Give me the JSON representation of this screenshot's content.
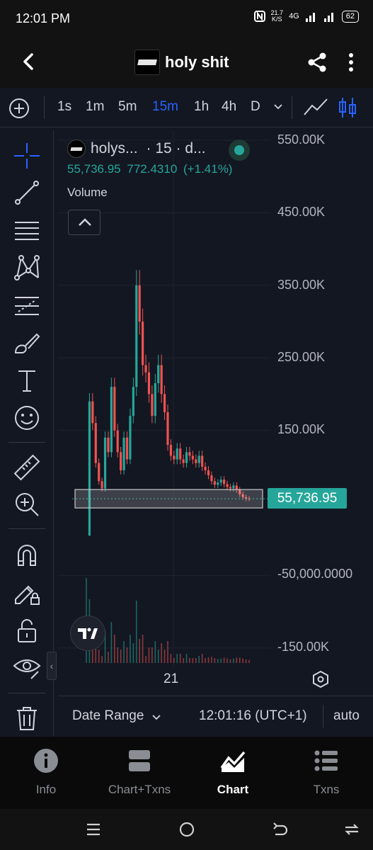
{
  "status_bar": {
    "time": "12:01 PM",
    "net_speed_value": "21.7",
    "net_speed_unit": "K/S",
    "network": "4G",
    "battery": "62"
  },
  "header": {
    "title": "holy shit",
    "back_icon": "chevron-left-icon",
    "share_icon": "share-icon",
    "more_icon": "more-vertical-icon"
  },
  "toolbar": {
    "timeframes": [
      "1s",
      "1m",
      "5m",
      "15m",
      "1h",
      "4h",
      "D"
    ],
    "active_timeframe": "15m"
  },
  "legend": {
    "symbol": "holys...",
    "meta": "· 15 · d...",
    "last": "55,736.95",
    "change": "772.4310",
    "change_pct": "(+1.41%)",
    "volume_label": "Volume"
  },
  "price_axis": {
    "labels": [
      "550.00K",
      "450.00K",
      "350.00K",
      "250.00K",
      "150.00K",
      "-50,000.0000",
      "-150.00K"
    ],
    "current_price": "55,736.95"
  },
  "time_axis": {
    "labels": [
      "21"
    ]
  },
  "range_bar": {
    "date_range": "Date Range",
    "clock": "12:01:16 (UTC+1)",
    "scale_mode": "auto"
  },
  "bottom_nav": {
    "items": [
      "Info",
      "Chart+Txns",
      "Chart",
      "Txns"
    ],
    "active": "Chart"
  },
  "colors": {
    "up": "#26a69a",
    "down": "#ef5350",
    "accent": "#2962ff",
    "background": "#131722"
  },
  "chart_data": {
    "type": "candlestick",
    "timeframe": "15",
    "close_series": [
      5000,
      190000,
      160000,
      105000,
      80000,
      70000,
      140000,
      120000,
      210000,
      150000,
      120000,
      95000,
      140000,
      110000,
      170000,
      210000,
      350000,
      300000,
      240000,
      230000,
      200000,
      170000,
      215000,
      240000,
      200000,
      175000,
      130000,
      115000,
      110000,
      125000,
      110000,
      105000,
      120000,
      115000,
      110000,
      105000,
      115000,
      100000,
      95000,
      88000,
      80000,
      75000,
      78000,
      82000,
      76000,
      72000,
      70000,
      74000,
      68000,
      62000,
      58000,
      56000,
      55737
    ],
    "current_price": 55736.95,
    "ylim": [
      -150000,
      550000
    ]
  }
}
